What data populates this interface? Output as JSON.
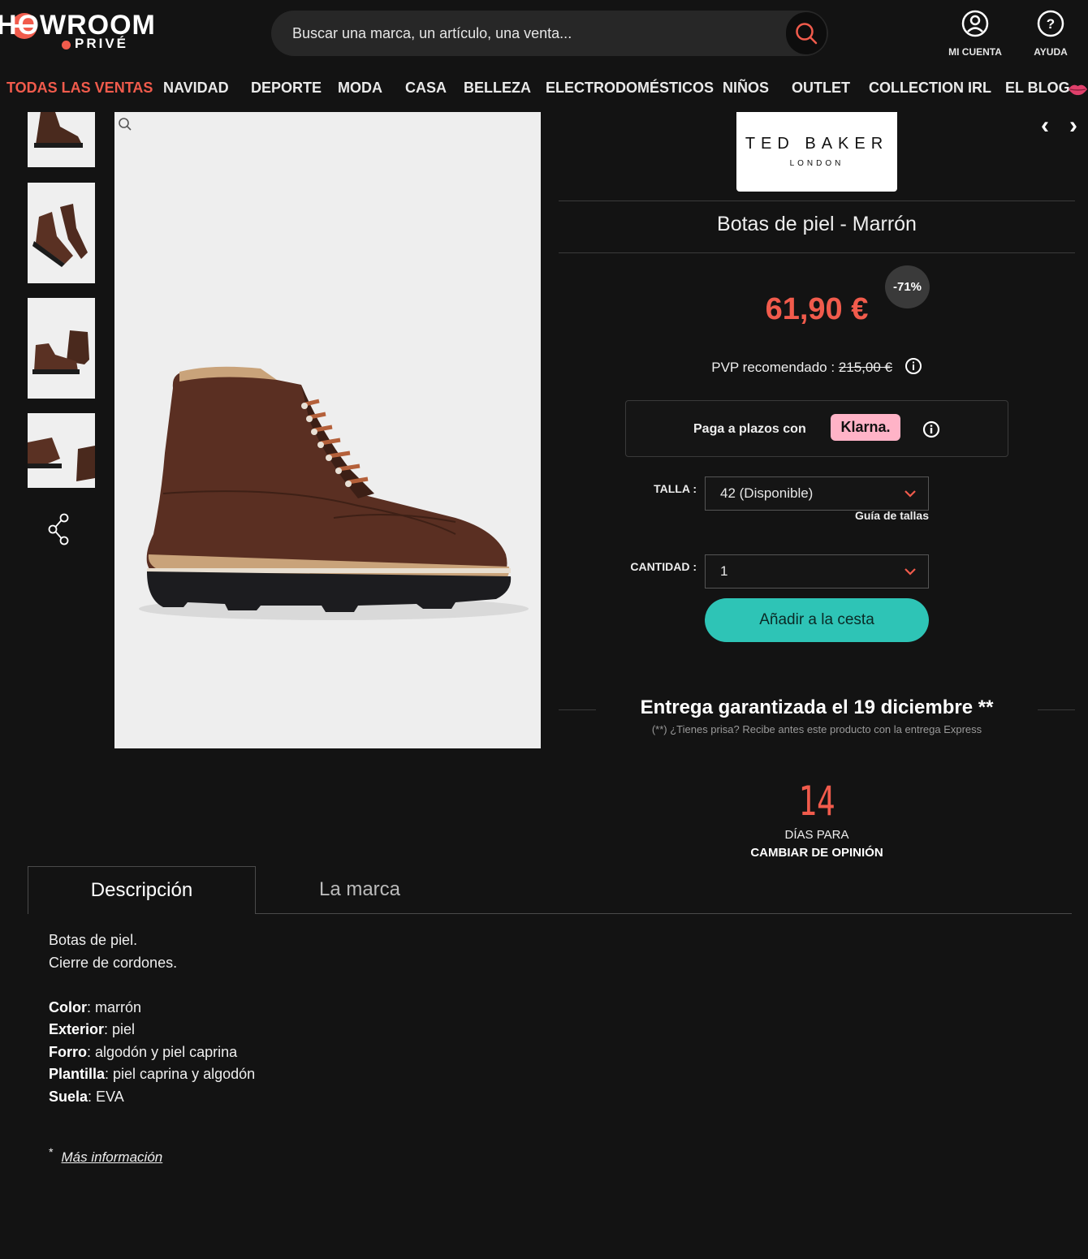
{
  "header": {
    "logo_main": "HOWROOM",
    "logo_sub": "PRIVÉ",
    "search_placeholder": "Buscar una marca, un artículo, una venta...",
    "account_label": "MI CUENTA",
    "help_label": "AYUDA"
  },
  "nav": [
    {
      "label": "TODAS LAS VENTAS",
      "active": true
    },
    {
      "label": "NAVIDAD"
    },
    {
      "label": "DEPORTE"
    },
    {
      "label": "MODA"
    },
    {
      "label": "CASA"
    },
    {
      "label": "BELLEZA"
    },
    {
      "label": "ELECTRODOMÉSTICOS"
    },
    {
      "label": "NIÑOS"
    },
    {
      "label": "OUTLET"
    },
    {
      "label": "COLLECTION IRL"
    },
    {
      "label": "EL BLOG"
    }
  ],
  "brand": {
    "name": "TED BAKER",
    "sub": "LONDON"
  },
  "product": {
    "title": "Botas de piel - Marrón",
    "price": "61,90 €",
    "discount": "-71%",
    "pvp_label": "PVP recomendado : ",
    "pvp_old": "215,00 €"
  },
  "klarna": {
    "text": "Paga a plazos con",
    "badge": "Klarna."
  },
  "size": {
    "label": "TALLA :",
    "value": "42 (Disponible)",
    "guide": "Guía de tallas"
  },
  "quantity": {
    "label": "CANTIDAD :",
    "value": "1"
  },
  "add_to_cart": "Añadir a la cesta",
  "delivery": {
    "title": "Entrega garantizada el 19 diciembre **",
    "sub": "(**) ¿Tienes prisa? Recibe antes este producto con la entrega Express"
  },
  "returns": {
    "days": "14",
    "line1": "DÍAS PARA",
    "line2": "CAMBIAR DE OPINIÓN"
  },
  "tabs": {
    "description": "Descripción",
    "brand": "La marca"
  },
  "description": {
    "line1": "Botas de piel.",
    "line2": "Cierre de cordones.",
    "specs": [
      {
        "key": "Color",
        "value": ": marrón"
      },
      {
        "key": "Exterior",
        "value": ": piel"
      },
      {
        "key": "Forro",
        "value": ": algodón y piel caprina"
      },
      {
        "key": "Plantilla",
        "value": ": piel caprina y algodón"
      },
      {
        "key": "Suela",
        "value": ": EVA"
      }
    ],
    "more_star": "*",
    "more_link": "Más información"
  },
  "colors": {
    "accent": "#f15b4c",
    "button": "#2ec4b6",
    "background": "#131313",
    "klarna": "#ffb3c7"
  }
}
